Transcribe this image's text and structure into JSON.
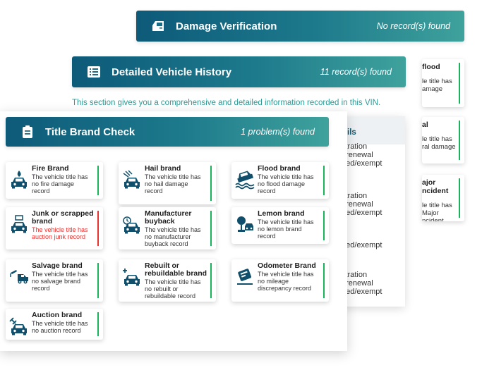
{
  "damage": {
    "title": "Damage Verification",
    "count": "No record(s) found",
    "icon": "car-door-icon"
  },
  "history": {
    "title": "Detailed Vehicle History",
    "count": "11 record(s) found",
    "icon": "list-icon",
    "intro": "This section gives you a comprehensive and detailed information recorded in this VIN."
  },
  "title_brand": {
    "title": "Title Brand Check",
    "count": "1 problem(s) found",
    "icon": "clipboard-icon"
  },
  "back_table": {
    "header": "ils",
    "lines": [
      "stration",
      "t/renewal",
      "ded/exempt",
      "stration",
      "t/renewal",
      "ded/exempt",
      "ded/exempt",
      "stration",
      "t/renewal",
      "ded/exempt"
    ]
  },
  "right_cards": [
    {
      "title": [
        "flood"
      ],
      "desc": [
        "le title has",
        "amage"
      ]
    },
    {
      "title": [
        "al"
      ],
      "desc": [
        "le title has",
        "ral damage"
      ]
    },
    {
      "title": [
        "ajor",
        "ncident"
      ],
      "desc": [
        "le title has",
        "Major",
        "ncident"
      ]
    }
  ],
  "cards": [
    {
      "title": [
        "Fire Brand"
      ],
      "desc": [
        "The vehicle title has",
        "no fire damage",
        "record"
      ],
      "status": "ok",
      "icon": "fire-car-icon"
    },
    {
      "title": [
        "Hail brand"
      ],
      "desc": [
        "The vehicle title has",
        "no hail damage",
        "record"
      ],
      "status": "ok",
      "icon": "hail-car-icon"
    },
    {
      "title": [
        "Flood brand"
      ],
      "desc": [
        "The vehicle title has",
        "no flood damage",
        "record"
      ],
      "status": "ok",
      "icon": "flood-car-icon"
    },
    {
      "title": [
        "Junk or scrapped",
        "brand"
      ],
      "desc": [
        "The vehicle title has",
        "auction junk record"
      ],
      "status": "problem",
      "icon": "junk-car-icon"
    },
    {
      "title": [
        "Manufacturer",
        "buyback"
      ],
      "desc": [
        "The vehicle title has",
        "no manufacturer",
        "buyback record"
      ],
      "status": "ok",
      "icon": "buyback-car-icon"
    },
    {
      "title": [
        "Lemon brand"
      ],
      "desc": [
        "The vehicle title has",
        "no lemon brand",
        "record"
      ],
      "status": "ok",
      "icon": "lemon-car-icon"
    },
    {
      "title": [
        "Salvage brand"
      ],
      "desc": [
        "The vehicle title has",
        "no salvage brand",
        "record"
      ],
      "status": "ok",
      "icon": "tow-truck-icon"
    },
    {
      "title": [
        "Rebuilt or",
        "rebuildable brand"
      ],
      "desc": [
        "The vehicle title has",
        "no rebuilt or",
        "rebuildable record"
      ],
      "status": "ok",
      "icon": "rebuilt-car-icon"
    },
    {
      "title": [
        "Odometer Brand"
      ],
      "desc": [
        "The vehicle title has",
        "no mileage",
        "discrepancy record"
      ],
      "status": "ok",
      "icon": "odometer-icon"
    },
    {
      "title": [
        "Auction brand"
      ],
      "desc": [
        "The vehicle title has",
        "no auction record"
      ],
      "status": "ok",
      "icon": "auction-car-icon"
    }
  ]
}
